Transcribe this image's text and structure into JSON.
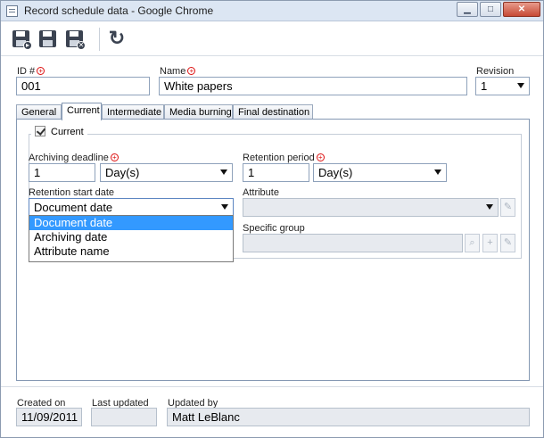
{
  "window": {
    "title": "Record schedule data - Google Chrome",
    "controls": {
      "minimize": "▁",
      "maximize": "□",
      "close": "✕"
    }
  },
  "toolbar": {
    "buttons": [
      {
        "name": "save-and-new-button",
        "icon": "save-new-icon",
        "badge": "▸"
      },
      {
        "name": "save-button",
        "icon": "floppy-disk-icon"
      },
      {
        "name": "save-and-close-button",
        "icon": "save-close-icon",
        "badge": "✕"
      },
      {
        "name": "refresh-button",
        "icon": "refresh-icon",
        "glyph": "↻"
      }
    ]
  },
  "header": {
    "id": {
      "label": "ID #",
      "value": "001"
    },
    "name": {
      "label": "Name",
      "value": "White papers"
    },
    "revision": {
      "label": "Revision",
      "value": "1"
    }
  },
  "tabs": [
    {
      "label": "General",
      "active": false
    },
    {
      "label": "Current",
      "active": true
    },
    {
      "label": "Intermediate",
      "active": false
    },
    {
      "label": "Media burning",
      "active": false
    },
    {
      "label": "Final destination",
      "active": false
    }
  ],
  "current": {
    "group_label": "Current",
    "checked": true,
    "archiving_deadline": {
      "label": "Archiving deadline",
      "value": "1",
      "unit": "Day(s)"
    },
    "retention_period": {
      "label": "Retention period",
      "value": "1",
      "unit": "Day(s)"
    },
    "retention_start_date": {
      "label": "Retention start date",
      "value": "Document date",
      "options": [
        "Document date",
        "Archiving date",
        "Attribute name"
      ],
      "highlighted": "Document date"
    },
    "attribute": {
      "label": "Attribute",
      "value": ""
    },
    "specific_group": {
      "label": "Specific group",
      "value": ""
    }
  },
  "footer": {
    "created_on": {
      "label": "Created on",
      "value": "11/09/2011"
    },
    "last_updated": {
      "label": "Last updated",
      "value": ""
    },
    "updated_by": {
      "label": "Updated by",
      "value": "Matt LeBlanc"
    }
  },
  "colors": {
    "accent": "#3399ff",
    "required": "#dd1111",
    "border": "#8fa2bb"
  }
}
